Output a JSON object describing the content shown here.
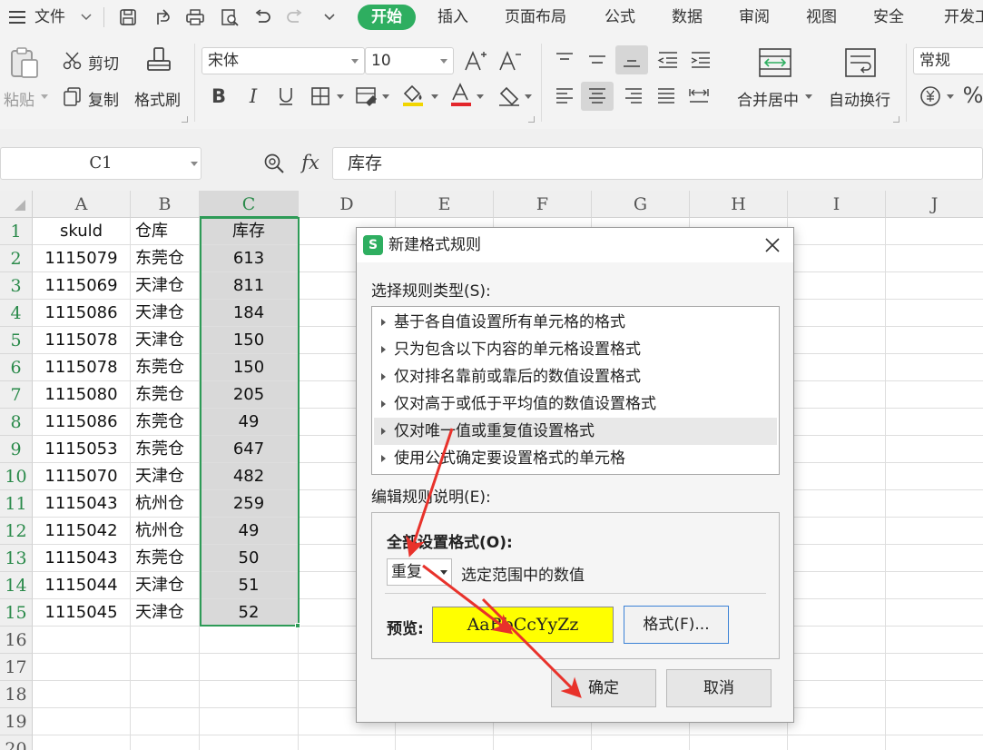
{
  "menu": {
    "file_label": "文件",
    "tabs": [
      "开始",
      "插入",
      "页面布局",
      "公式",
      "数据",
      "审阅",
      "视图",
      "安全",
      "开发工"
    ],
    "active_tab": "开始"
  },
  "ribbon": {
    "paste": "粘贴",
    "cut": "剪切",
    "copy": "复制",
    "format_painter": "格式刷",
    "font_name": "宋体",
    "font_size": "10",
    "merge_center": "合并居中",
    "auto_wrap": "自动换行",
    "number_format": "常规"
  },
  "formula_bar": {
    "name_box": "C1",
    "fx_label": "fx",
    "content": "库存"
  },
  "grid": {
    "columns": [
      "A",
      "B",
      "C",
      "D",
      "E",
      "F",
      "G",
      "H",
      "I",
      "J"
    ],
    "selected_column": "C",
    "rows": [
      {
        "n": "1",
        "a": "skuld",
        "b": "仓库",
        "c": "库存"
      },
      {
        "n": "2",
        "a": "1115079",
        "b": "东莞仓",
        "c": "613"
      },
      {
        "n": "3",
        "a": "1115069",
        "b": "天津仓",
        "c": "811"
      },
      {
        "n": "4",
        "a": "1115086",
        "b": "天津仓",
        "c": "184"
      },
      {
        "n": "5",
        "a": "1115078",
        "b": "天津仓",
        "c": "150"
      },
      {
        "n": "6",
        "a": "1115078",
        "b": "东莞仓",
        "c": "150"
      },
      {
        "n": "7",
        "a": "1115080",
        "b": "东莞仓",
        "c": "205"
      },
      {
        "n": "8",
        "a": "1115086",
        "b": "东莞仓",
        "c": "49"
      },
      {
        "n": "9",
        "a": "1115053",
        "b": "东莞仓",
        "c": "647"
      },
      {
        "n": "10",
        "a": "1115070",
        "b": "天津仓",
        "c": "482"
      },
      {
        "n": "11",
        "a": "1115043",
        "b": "杭州仓",
        "c": "259"
      },
      {
        "n": "12",
        "a": "1115042",
        "b": "杭州仓",
        "c": "49"
      },
      {
        "n": "13",
        "a": "1115043",
        "b": "东莞仓",
        "c": "50"
      },
      {
        "n": "14",
        "a": "1115044",
        "b": "天津仓",
        "c": "51"
      },
      {
        "n": "15",
        "a": "1115045",
        "b": "天津仓",
        "c": "52"
      },
      {
        "n": "16",
        "a": "",
        "b": "",
        "c": ""
      },
      {
        "n": "17",
        "a": "",
        "b": "",
        "c": ""
      },
      {
        "n": "18",
        "a": "",
        "b": "",
        "c": ""
      },
      {
        "n": "19",
        "a": "",
        "b": "",
        "c": ""
      },
      {
        "n": "20",
        "a": "",
        "b": "",
        "c": ""
      }
    ]
  },
  "dialog": {
    "title": "新建格式规则",
    "rule_type_label": "选择规则类型(S):",
    "rule_types": [
      "基于各自值设置所有单元格的格式",
      "只为包含以下内容的单元格设置格式",
      "仅对排名靠前或靠后的数值设置格式",
      "仅对高于或低于平均值的数值设置格式",
      "仅对唯一值或重复值设置格式",
      "使用公式确定要设置格式的单元格"
    ],
    "selected_rule_type": "仅对唯一值或重复值设置格式",
    "edit_label": "编辑规则说明(E):",
    "format_all_label": "全部设置格式(O):",
    "dup_value": "重复",
    "dup_suffix": "选定范围中的数值",
    "preview_label": "预览:",
    "preview_text": "AaBbCcYyZz",
    "format_button": "格式(F)...",
    "ok_button": "确定",
    "cancel_button": "取消"
  },
  "colors": {
    "accent_green": "#2eae60",
    "selection_green": "#2e9b57",
    "preview_fill": "#ffff00",
    "annotation_red": "#e8322b"
  }
}
